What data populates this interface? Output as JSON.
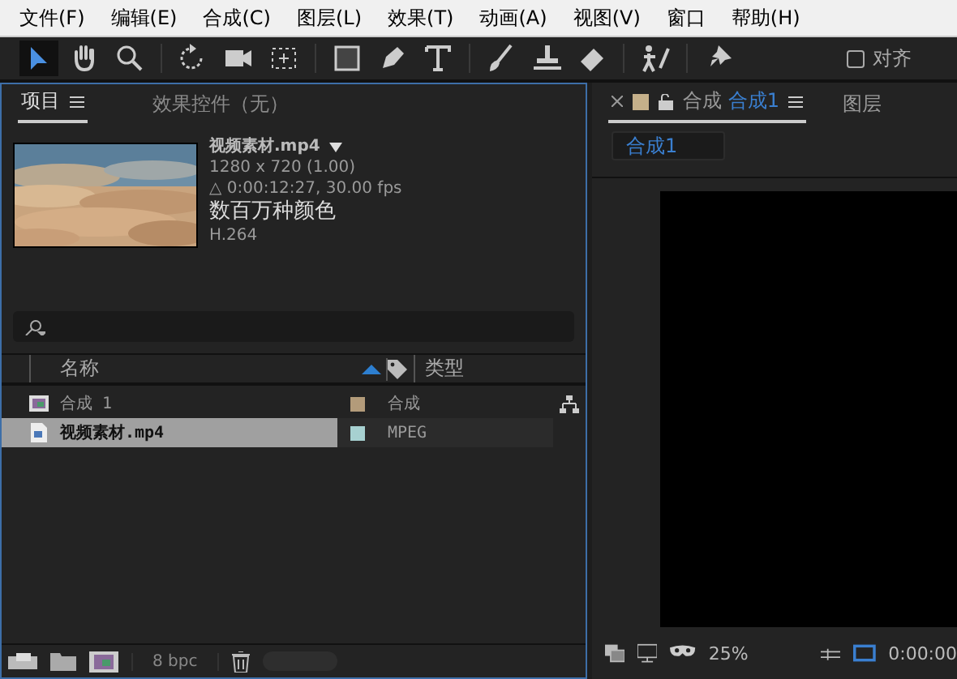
{
  "menu": [
    "文件(F)",
    "编辑(E)",
    "合成(C)",
    "图层(L)",
    "效果(T)",
    "动画(A)",
    "视图(V)",
    "窗口",
    "帮助(H)"
  ],
  "toolbar": {
    "tools": [
      {
        "kind": "select",
        "selected": true
      },
      {
        "kind": "hand",
        "selected": false
      },
      {
        "kind": "zoom",
        "selected": false
      },
      {
        "kind": "rotate",
        "selected": false
      },
      {
        "kind": "camera",
        "selected": false
      },
      {
        "kind": "pan",
        "selected": false
      },
      {
        "kind": "rect",
        "selected": false
      },
      {
        "kind": "pen",
        "selected": false
      },
      {
        "kind": "text",
        "selected": false
      },
      {
        "kind": "brush",
        "selected": false
      },
      {
        "kind": "stamp",
        "selected": false
      },
      {
        "kind": "eraser",
        "selected": false
      },
      {
        "kind": "puppet",
        "selected": false
      },
      {
        "kind": "pin",
        "selected": false
      }
    ],
    "align": {
      "label": "对齐",
      "checked": false
    }
  },
  "project": {
    "tabs": [
      {
        "label": "项目",
        "selected": true
      },
      {
        "label": "效果控件（无）",
        "selected": false
      }
    ],
    "preview": {
      "name": "视频素材.mp4",
      "size": "1280 x 720 (1.00)",
      "duration": "△ 0:00:12:27, 30.00 fps",
      "colors": "数百万种颜色",
      "codec": "H.264"
    },
    "columns": [
      "名称",
      "类型"
    ],
    "rows": [
      {
        "kind": "composition",
        "name": "合成 1",
        "color": "#b39b7a",
        "type": "合成",
        "selected": false
      },
      {
        "kind": "footage",
        "name": "视频素材.mp4",
        "color": "#a7d1d1",
        "type": "MPEG",
        "selected": true
      }
    ],
    "bpc": "8 bpc"
  },
  "composition": {
    "tab": {
      "prefix": "合成",
      "name": "合成1",
      "color": "#c5b08a",
      "selected": true
    },
    "other_tab": "图层",
    "breadcrumb": "合成1",
    "zoom": "25%",
    "timecode": "0:00:00"
  }
}
